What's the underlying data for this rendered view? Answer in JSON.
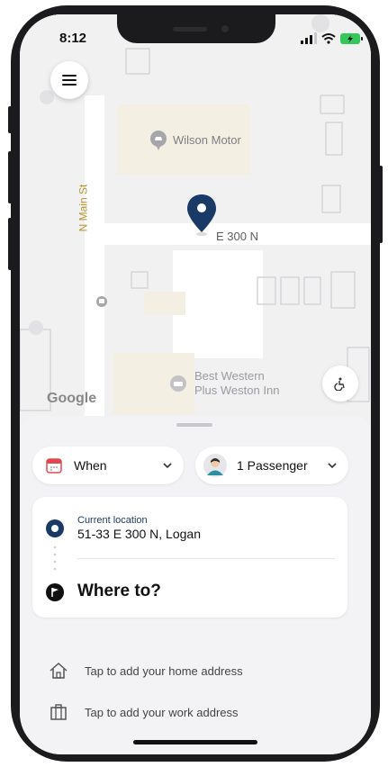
{
  "status_bar": {
    "time": "8:12"
  },
  "map": {
    "poi_wilson_motor": "Wilson Motor",
    "street_main": "N Main St",
    "street_e300": "E 300 N",
    "poi_best_western_line1": "Best Western",
    "poi_best_western_line2": "Plus Weston Inn",
    "attribution": "Google"
  },
  "booking": {
    "when_label": "When",
    "passenger_label": "1 Passenger",
    "current_location_label": "Current location",
    "current_location_address": "51-33 E 300 N, Logan",
    "destination_placeholder": "Where to?",
    "home_shortcut": "Tap to add your home address",
    "work_shortcut": "Tap to add your work address"
  },
  "colors": {
    "accent_navy": "#1a3a66",
    "sheet_background": "#f3f3f5",
    "calendar_red": "#e0484f",
    "battery_green": "#35c759"
  },
  "icons": {
    "menu": "hamburger-icon",
    "map_pin": "location-pin-icon",
    "accessibility": "wheelchair-icon",
    "calendar": "calendar-icon",
    "passenger": "person-avatar-icon",
    "origin": "origin-dot-icon",
    "destination": "flag-icon",
    "home": "home-icon",
    "work": "briefcase-icon"
  }
}
